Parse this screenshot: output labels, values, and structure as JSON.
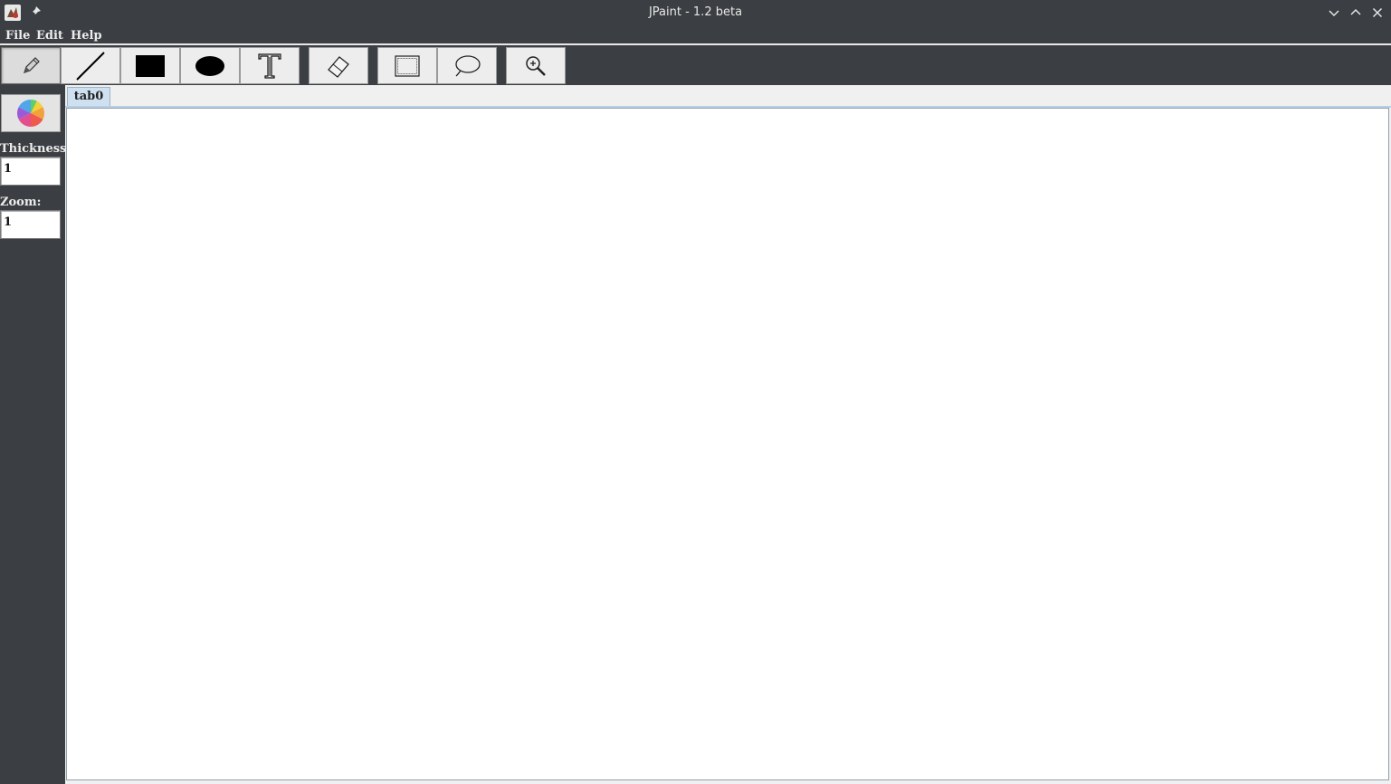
{
  "window": {
    "title": "JPaint - 1.2 beta",
    "icons": [
      "app-icon",
      "pin-icon",
      "minimize-icon",
      "maximize-icon",
      "close-icon"
    ]
  },
  "menubar": {
    "items": [
      {
        "label": "File"
      },
      {
        "label": "Edit"
      },
      {
        "label": "Help"
      }
    ]
  },
  "toolbar": {
    "tools": [
      {
        "name": "pencil",
        "icon": "pencil-icon",
        "selected": true
      },
      {
        "name": "line",
        "icon": "line-icon",
        "selected": false
      },
      {
        "name": "rectangle",
        "icon": "filled-rectangle-icon",
        "selected": false
      },
      {
        "name": "ellipse",
        "icon": "filled-ellipse-icon",
        "selected": false
      },
      {
        "name": "text",
        "icon": "text-icon",
        "selected": false
      },
      {
        "name": "eraser",
        "icon": "eraser-icon",
        "selected": false
      },
      {
        "name": "rect-select",
        "icon": "rect-select-icon",
        "selected": false
      },
      {
        "name": "lasso-select",
        "icon": "lasso-icon",
        "selected": false
      },
      {
        "name": "zoom",
        "icon": "zoom-icon",
        "selected": false
      }
    ]
  },
  "sidebar": {
    "color_icon": "color-wheel-icon",
    "thickness_label": "Thickness:",
    "thickness_value": "1",
    "zoom_label": "Zoom:",
    "zoom_value": "1"
  },
  "tabs": [
    {
      "label": "tab0",
      "active": true
    }
  ],
  "colors": {
    "chrome": "#3b3e42",
    "tab_active": "#cfe0f0",
    "canvas": "#ffffff"
  }
}
